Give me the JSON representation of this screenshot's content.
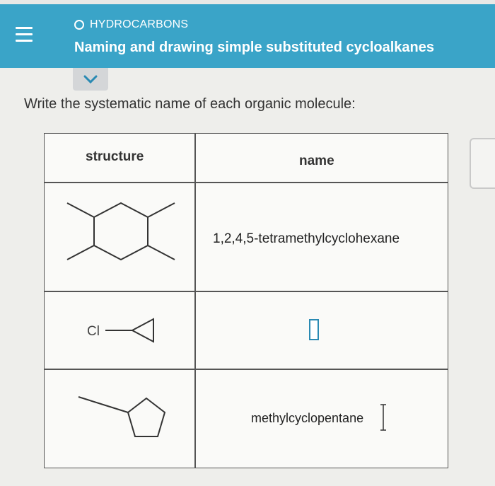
{
  "header": {
    "topic": "HYDROCARBONS",
    "title": "Naming and drawing simple substituted cycloalkanes"
  },
  "prompt": "Write the systematic name of each organic molecule:",
  "table": {
    "columns": [
      "structure",
      "name"
    ],
    "rows": [
      {
        "structure_icon": "tetramethylcyclohexane-structure",
        "name": "1,2,4,5-tetramethylcyclohexane"
      },
      {
        "structure_icon": "chlorocyclopropane-structure",
        "structure_label": "Cl",
        "name": ""
      },
      {
        "structure_icon": "methylcyclopentane-structure",
        "name": "methylcyclopentane"
      }
    ]
  },
  "colors": {
    "header_bg": "#3aa4c8",
    "answer_box_border": "#2a8ab3"
  }
}
